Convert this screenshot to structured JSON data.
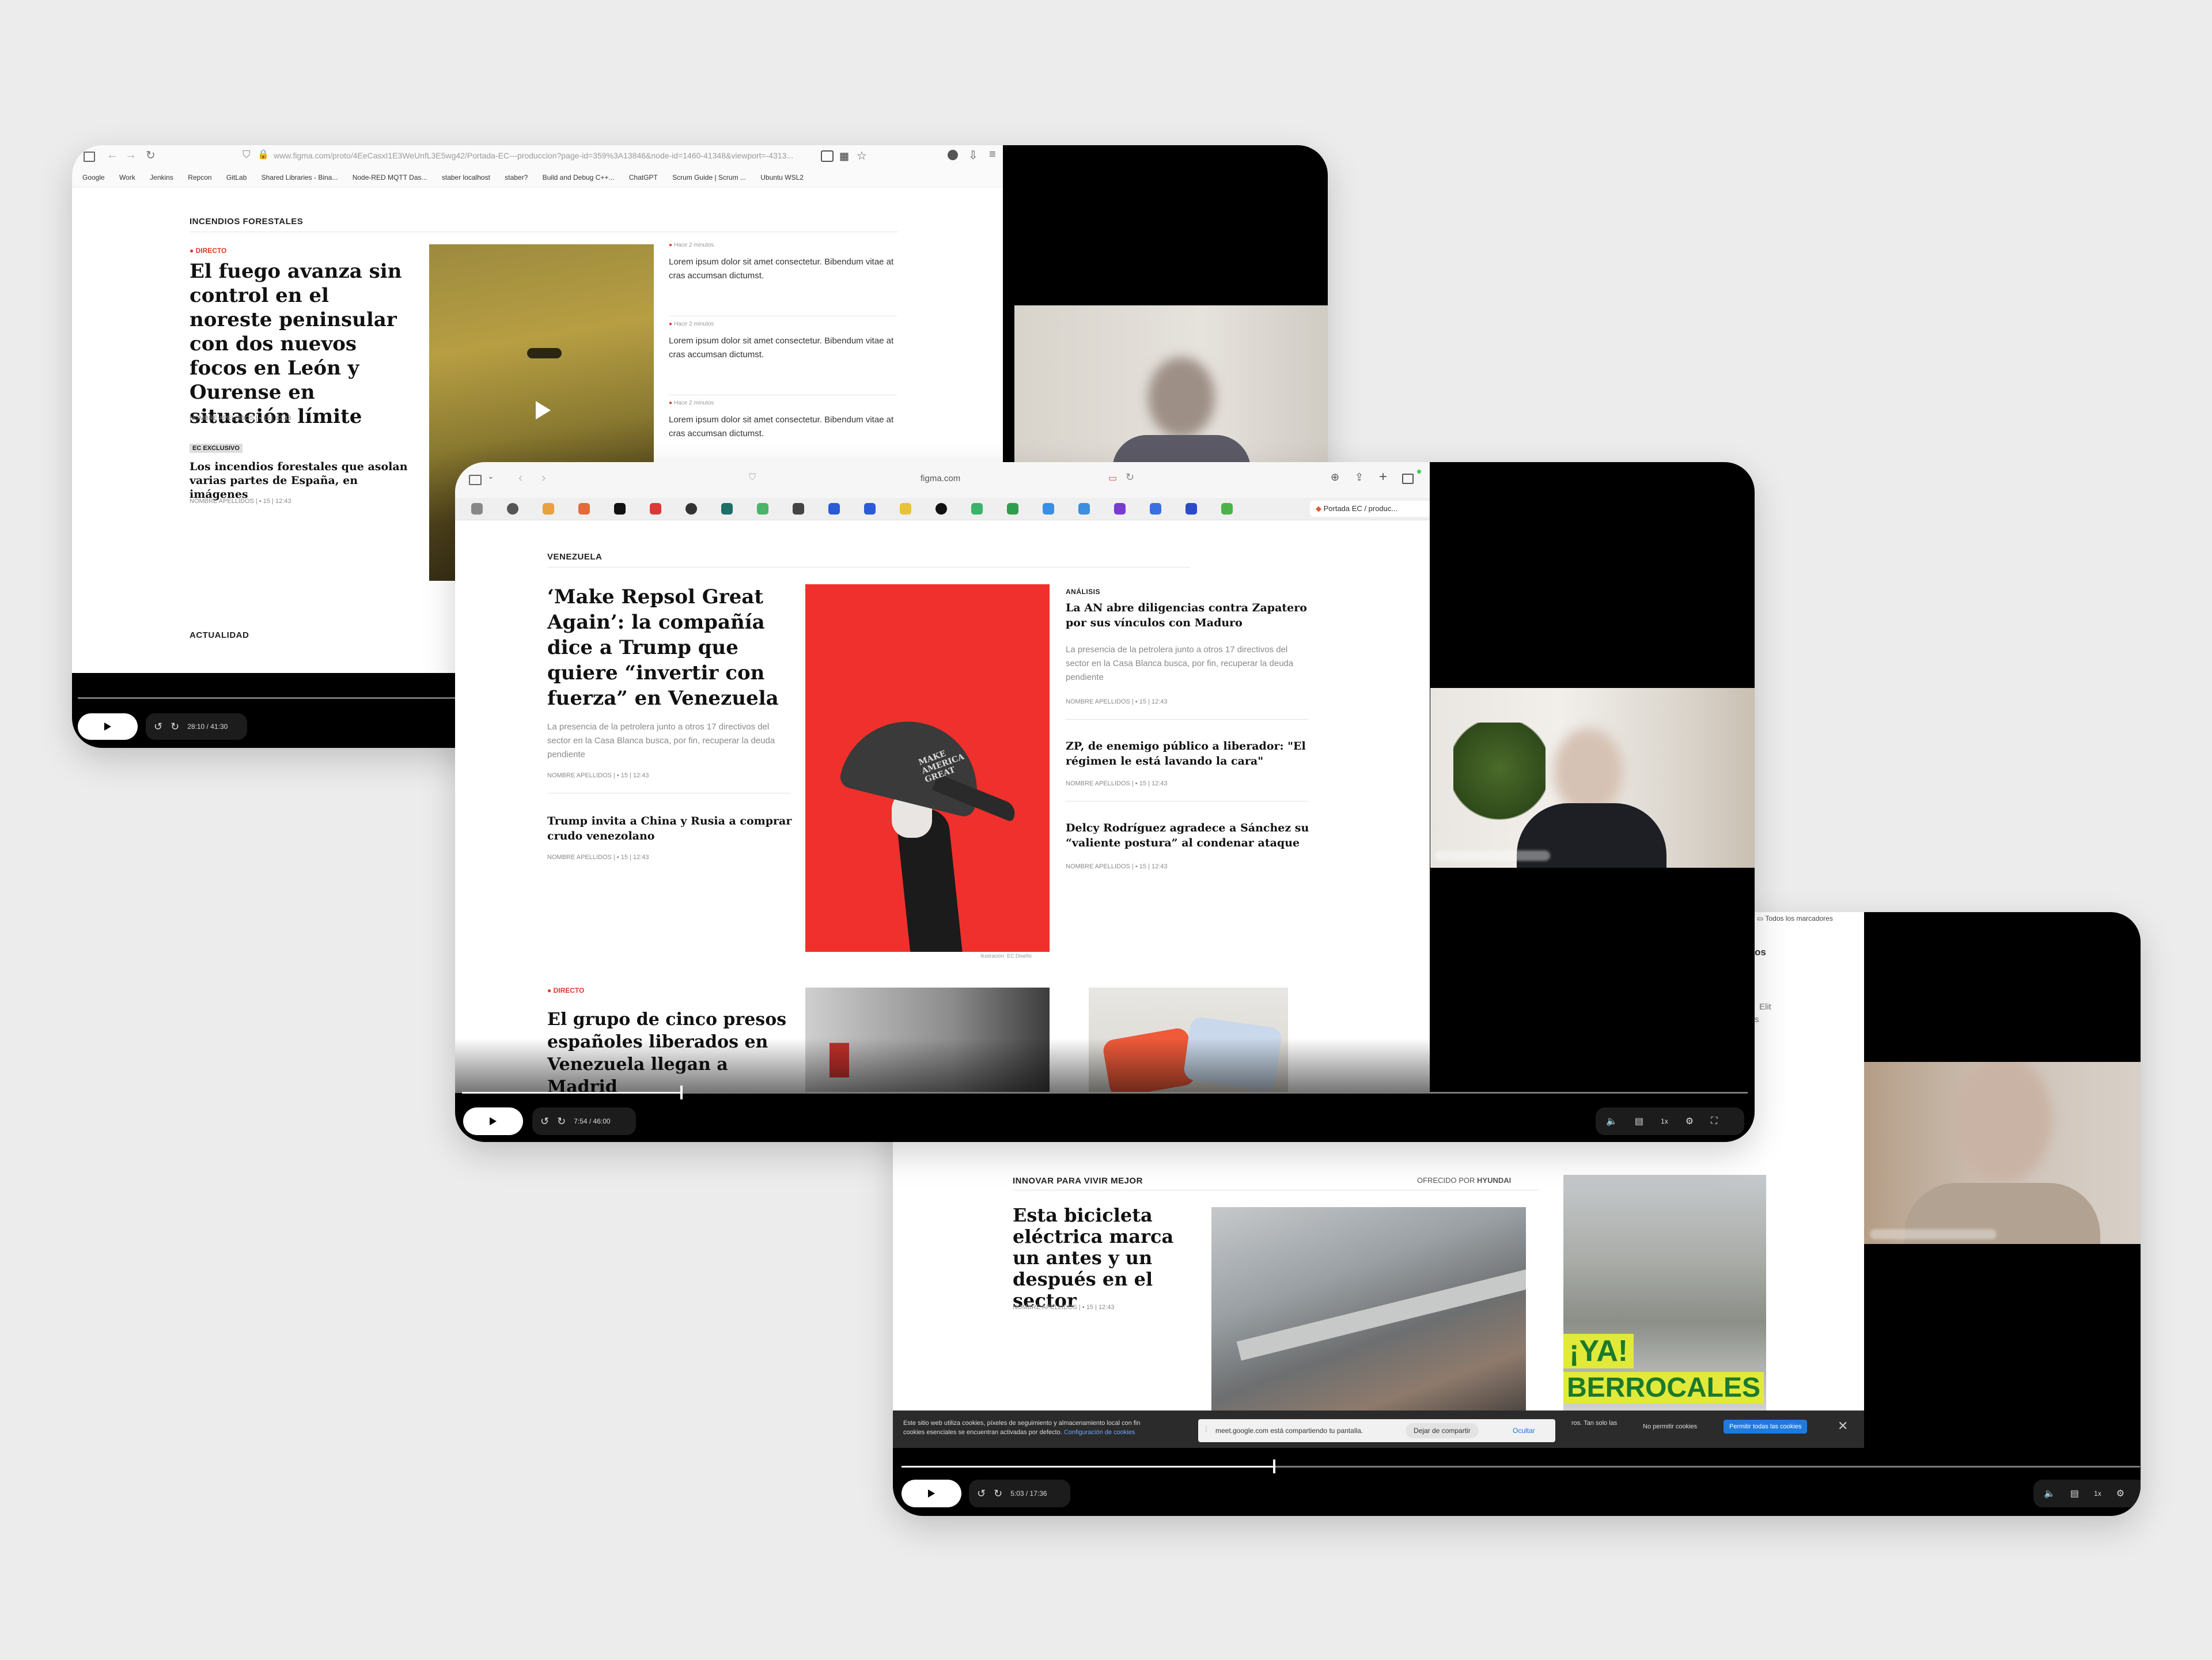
{
  "p1": {
    "url": "www.figma.com/proto/4EeCasxI1E3WeUnfL3E5wg42/Portada-EC---produccion?page-id=359%3A13846&node-id=1460-41348&viewport=-4313...",
    "bookmarks": [
      "Google",
      "Work",
      "Jenkins",
      "Repcon",
      "GitLab",
      "Shared Libraries - Bina...",
      "Node-RED MQTT Das...",
      "staber localhost",
      "staber?",
      "Build and Debug C++...",
      "ChatGPT",
      "Scrum Guide | Scrum ...",
      "Ubuntu WSL2"
    ],
    "section": "INCENDIOS FORESTALES",
    "live": "DIRECTO",
    "headline": "El fuego avanza sin control en el noreste peninsular con dos nuevos focos en León y Ourense en situación límite",
    "meta": "NOMBRE APELLIDOS | ▪ 15 | 12:43",
    "badge": "EC EXCLUSIVO",
    "headline2": "Los incendios forestales que asolan varias partes de España, en imágenes",
    "meta2": "NOMBRE APELLIDOS | ▪ 15 | 12:43",
    "feed": [
      {
        "time": "Hace 2 minutos",
        "text": "Lorem ipsum dolor sit amet consectetur. Bibendum vitae at cras accumsan dictumst."
      },
      {
        "time": "Hace 2 minutos",
        "text": "Lorem ipsum dolor sit amet consectetur. Bibendum vitae at cras accumsan dictumst."
      },
      {
        "time": "Hace 2 minutos",
        "text": "Lorem ipsum dolor sit amet consectetur. Bibendum vitae at cras accumsan dictumst."
      }
    ],
    "section2": "ACTUALIDAD",
    "time": "28:10 / 41:30"
  },
  "p2": {
    "url": "figma.com",
    "tab": "Portada EC / produc...",
    "section": "VENEZUELA",
    "headline": "‘Make Repsol Great Again’: la compañía dice a Trump que quiere “invertir con fuerza” en Venezuela",
    "summary": "La presencia de la petrolera junto a otros 17 directivos del sector en la Casa Blanca busca, por fin, recuperar la deuda pendiente",
    "meta": "NOMBRE APELLIDOS | ▪ 15 | 12:43",
    "sub": "Trump invita a China y Rusia a comprar crudo venezolano",
    "sub_meta": "NOMBRE APELLIDOS | ▪ 15 | 12:43",
    "caption": "Ilustración: EC Diseño",
    "cap_text": "MAKE AMERICA GREAT",
    "analysis_kicker": "ANÁLISIS",
    "analysis_headline": "La AN abre diligencias contra Zapatero por sus vínculos con Maduro",
    "analysis_summary": "La presencia de la petrolera junto a otros 17 directivos del sector en la Casa Blanca busca, por fin, recuperar la deuda pendiente",
    "analysis_meta": "NOMBRE APELLIDOS | ▪ 15 | 12:43",
    "right2_headline": "ZP, de enemigo público a liberador: \"El régimen le está lavando la cara\"",
    "right2_meta": "NOMBRE APELLIDOS | ▪ 15 | 12:43",
    "right3_headline": "Delcy Rodríguez agradece a Sánchez su “valiente postura” al condenar ataque",
    "right3_meta": "NOMBRE APELLIDOS | ▪ 15 | 12:43",
    "live": "DIRECTO",
    "bottom_headline": "El grupo de cinco presos españoles liberados en Venezuela llegan a Madrid",
    "time": "7:54 / 46:00",
    "speed": "1x",
    "progress": 0.17
  },
  "p3": {
    "bookmarks_label": "Todos los marcadores",
    "side_text": [
      "os",
      "Elit",
      "s"
    ],
    "section": "INNOVAR PARA VIVIR MEJOR",
    "sponsor_prefix": "OFRECIDO POR",
    "sponsor": "HYUNDAI",
    "headline": "Esta bicicleta eléctrica marca un antes y un después en el sector",
    "meta": "NOMBRE APELLIDOS | ▪ 15 | 12:43",
    "ad_line1": "¡YA!",
    "ad_line2": "BERROCALES",
    "cookie_text": "Este sitio web utiliza cookies, píxeles de seguimiento y almacenamiento local con fin",
    "cookie_text2": "cookies esenciales se encuentran activadas por defecto.",
    "cookie_link": "Configuración de cookies",
    "cookie_tail": "ros. Tan solo las",
    "share_text": "meet.google.com está compartiendo tu pantalla.",
    "share_stop": "Dejar de compartir",
    "share_hide": "Ocultar",
    "deny": "No permitir cookies",
    "allow": "Permitir todas las cookies",
    "time": "5:03 / 17:36",
    "speed": "1x",
    "progress": 0.3
  },
  "colors": {
    "accent_red": "#e0382f",
    "cookie_blue": "#1f7ae0",
    "ad_yellow": "#e1ea3a"
  }
}
